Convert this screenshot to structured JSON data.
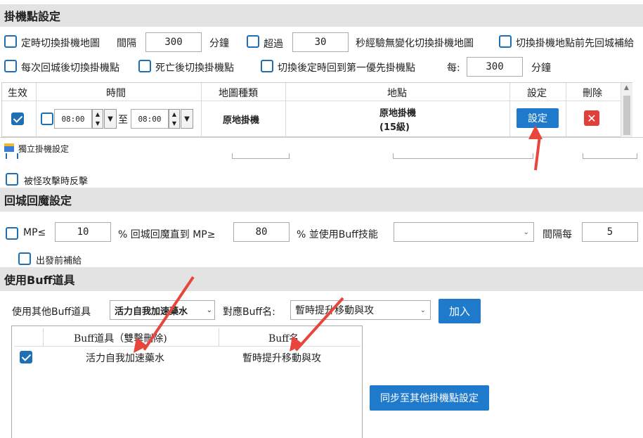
{
  "afk_settings": {
    "title": "掛機點設定",
    "row1": {
      "timed_switch_label": "定時切換掛機地圖",
      "interval_label": "間隔",
      "interval_value": "300",
      "minutes_label": "分鐘",
      "exceed_label": "超過",
      "exceed_value": "30",
      "seconds_no_change_label": "秒經驗無變化切換掛機地圖",
      "return_supply_label": "切換掛機地點前先回城補給"
    },
    "row2": {
      "switch_after_return_label": "每次回城後切換掛機點",
      "switch_after_death_label": "死亡後切換掛機點",
      "return_first_label": "切換後定時回到第一優先掛機點",
      "every_label": "每:",
      "every_value": "300",
      "minutes_label": "分鐘"
    },
    "table": {
      "headers": [
        "生效",
        "時間",
        "地圖種類",
        "地點",
        "設定",
        "刪除"
      ],
      "row": {
        "time_from": "08:00",
        "to_label": "至",
        "time_to": "08:00",
        "map_type": "原地掛機",
        "location_line1": "原地掛機",
        "location_line2": "(15級)",
        "settings_button": "設定",
        "delete_icon": "close-icon"
      }
    }
  },
  "independent_window": {
    "title": "獨立掛機設定",
    "counter_attack_label": "被怪攻擊時反擊"
  },
  "mp_section": {
    "title": "回城回魔設定",
    "mp_label": "MP≤",
    "mp_value": "10",
    "return_until_label": "% 回城回魔直到 MP≥",
    "until_value": "80",
    "buff_skill_label": "% 並使用Buff技能",
    "buff_skill_value": "",
    "interval_label": "間隔每",
    "interval_value": "5",
    "supply_before_label": "出發前補給"
  },
  "buff_section": {
    "title": "使用Buff道具",
    "use_other_label": "使用其他Buff道具",
    "item_select_value": "活力自我加速藥水",
    "buff_name_label": "對應Buff名:",
    "buff_select_value": "暫時提升移動與攻",
    "add_button": "加入",
    "table_headers": [
      "Buff道具（雙擊刪除)",
      "Buff名"
    ],
    "rows": [
      {
        "checked": true,
        "item": "活力自我加速藥水",
        "buff": "暫時提升移動與攻"
      }
    ],
    "sync_button": "同步至其他掛機點設定"
  },
  "colors": {
    "accent": "#1f7acc",
    "header_bg": "#e3e3e3",
    "annotation_arrow": "#e8453c",
    "delete_red": "#e0403a"
  }
}
